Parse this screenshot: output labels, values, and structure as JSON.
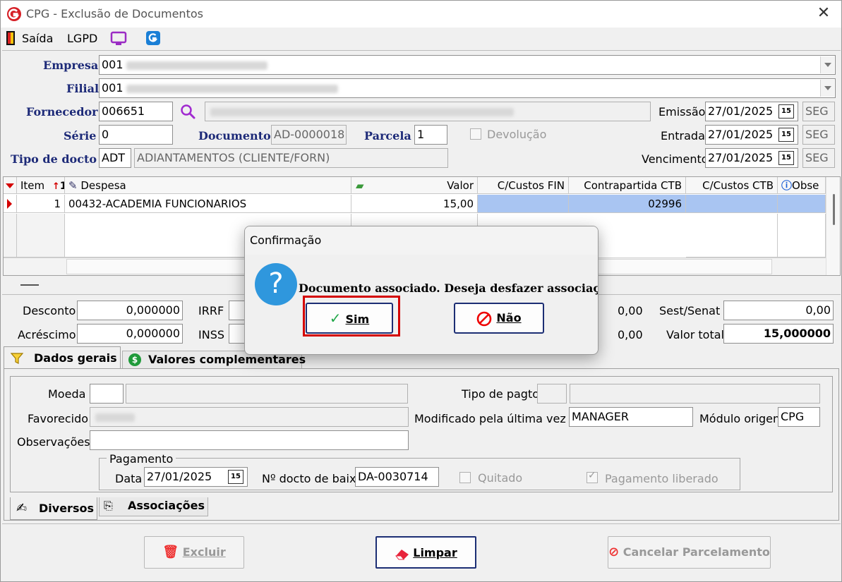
{
  "window": {
    "title": "CPG - Exclusão de Documentos"
  },
  "toolbar": {
    "saida": "Saída",
    "lgpd": "LGPD"
  },
  "form": {
    "empresa_label": "Empresa",
    "empresa_code": "001",
    "filial_label": "Filial",
    "filial_code": "001",
    "fornecedor_label": "Fornecedor",
    "fornecedor_code": "006651",
    "emissao_label": "Emissão",
    "emissao_value": "27/01/2025",
    "emissao_day": "SEG",
    "serie_label": "Série",
    "serie_value": "0",
    "documento_label": "Documento",
    "documento_value": "AD-0000018",
    "parcela_label": "Parcela",
    "parcela_value": "1",
    "devolucao_label": "Devolução",
    "entrada_label": "Entrada",
    "entrada_value": "27/01/2025",
    "entrada_day": "SEG",
    "tipo_label": "Tipo de docto",
    "tipo_code": "ADT",
    "tipo_desc": "ADIANTAMENTOS (CLIENTE/FORN)",
    "vencimento_label": "Vencimento",
    "vencimento_value": "27/01/2025",
    "vencimento_day": "SEG",
    "cal_icon_text": "15"
  },
  "grid": {
    "headers": {
      "item": "Item",
      "item_sort": "1",
      "despesa": "Despesa",
      "valor": "Valor",
      "ccfin": "C/Custos FIN",
      "contrapartida": "Contrapartida CTB",
      "ccctb": "C/Custos CTB",
      "obse": "Obse"
    },
    "row": {
      "item": "1",
      "despesa": "00432-ACADEMIA FUNCIONARIOS",
      "valor": "15,00",
      "contrapartida": "02996"
    }
  },
  "totals": {
    "desconto_label": "Desconto",
    "desconto_value": "0,000000",
    "acrescimo_label": "Acréscimo",
    "acrescimo_value": "0,000000",
    "irrf_label": "IRRF",
    "inss_label": "INSS",
    "mid1_value": "0,00",
    "mid2_value": "0,00",
    "sest_label": "Sest/Senat",
    "sest_value": "0,00",
    "total_label": "Valor total",
    "total_value": "15,000000"
  },
  "tabs": {
    "dados_gerais": "Dados gerais",
    "valores_comp": "Valores complementares",
    "diversos": "Diversos",
    "associacoes": "Associações"
  },
  "details": {
    "moeda_label": "Moeda",
    "tipo_pagto_label": "Tipo de pagto",
    "favorecido_label": "Favorecido",
    "modificado_label": "Modificado pela última vez por",
    "modificado_value": "MANAGER",
    "modulo_label": "Módulo origem",
    "modulo_value": "CPG",
    "obs_label": "Observações",
    "pagamento_legend": "Pagamento",
    "data_label": "Data",
    "data_value": "27/01/2025",
    "docto_baixa_label": "Nº docto de baixa",
    "docto_baixa_value": "DA-0030714",
    "quitado_label": "Quitado",
    "liberado_label": "Pagamento liberado"
  },
  "buttons": {
    "excluir": "Excluir",
    "limpar": "Limpar",
    "cancelar": "Cancelar Parcelamento"
  },
  "dialog": {
    "title": "Confirmação",
    "message": "Documento associado. Deseja desfazer associação ?",
    "sim": "Sim",
    "nao": "Não"
  },
  "colors": {
    "label_blue": "#1d2a78",
    "selection": "#a9c5f2",
    "highlight_red": "#d40000"
  }
}
